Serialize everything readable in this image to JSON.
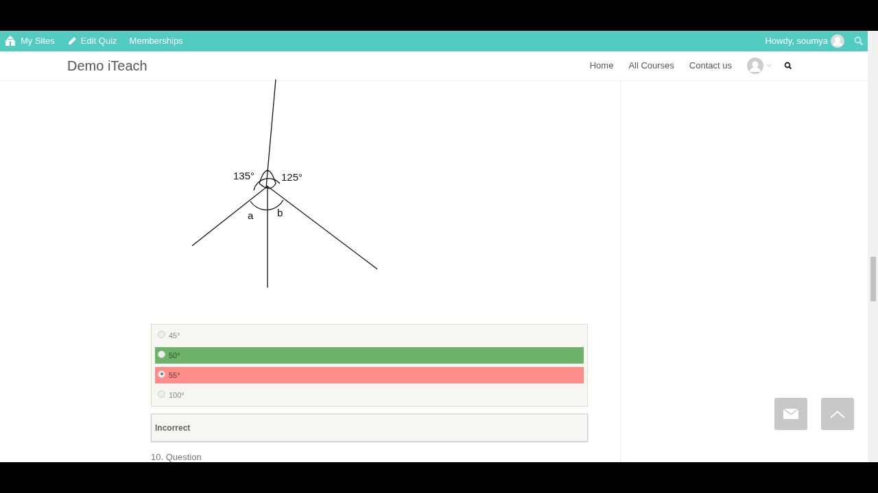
{
  "admin_bar": {
    "left": [
      {
        "kind": "sites",
        "label": "My Sites"
      },
      {
        "kind": "edit",
        "label": "Edit Quiz"
      },
      {
        "kind": "plain",
        "label": "Memberships"
      }
    ],
    "greeting": "Howdy, soumya"
  },
  "header": {
    "site_title": "Demo iTeach",
    "nav": [
      "Home",
      "All Courses",
      "Contact us"
    ]
  },
  "diagram": {
    "labels": [
      "135°",
      "125°",
      "a",
      "b"
    ]
  },
  "answers": [
    {
      "label": "45°",
      "selected": false,
      "kind": "neutral"
    },
    {
      "label": "50°",
      "selected": false,
      "kind": "correct"
    },
    {
      "label": "55°",
      "selected": true,
      "kind": "incorrect"
    },
    {
      "label": "100°",
      "selected": false,
      "kind": "neutral"
    }
  ],
  "result": "Incorrect",
  "next_question": "10. Question"
}
